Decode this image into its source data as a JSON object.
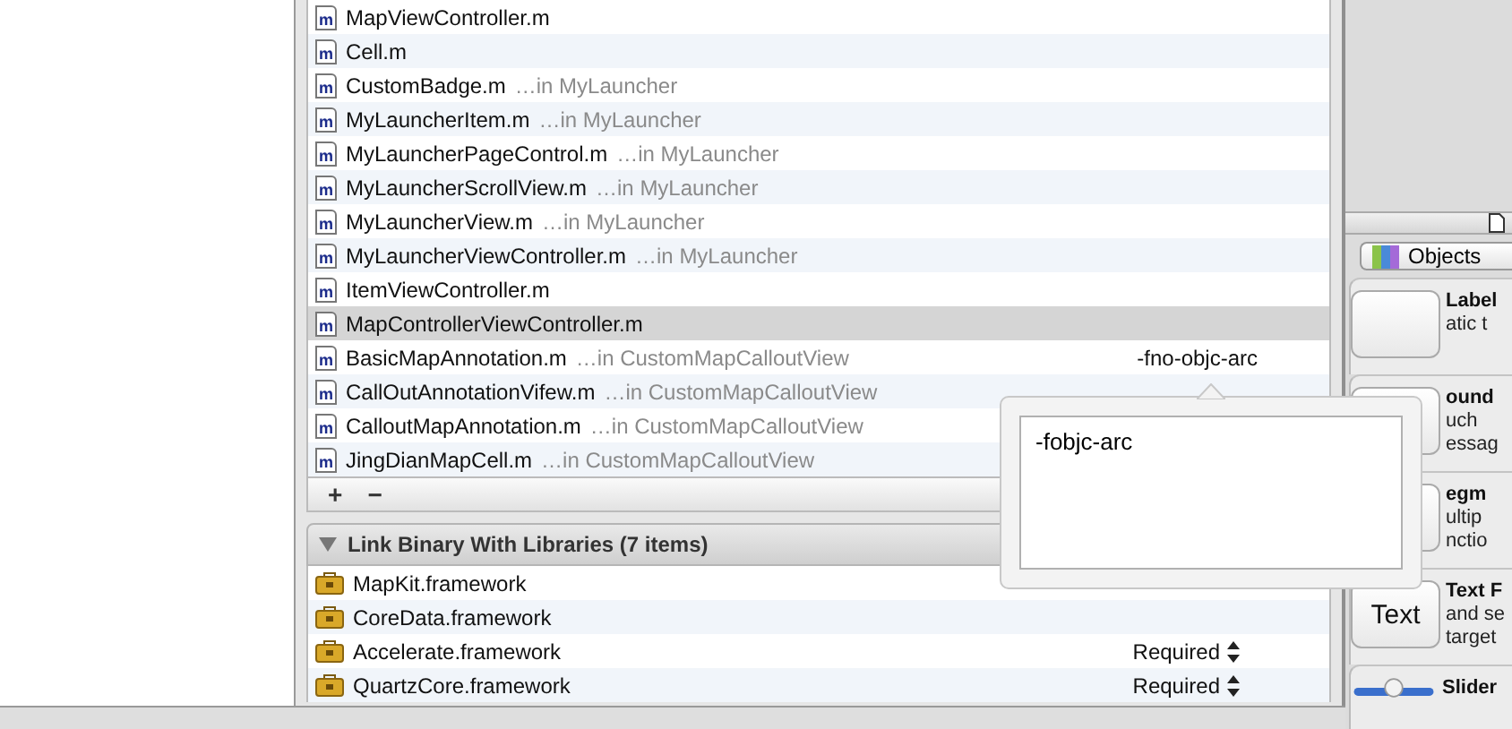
{
  "file_list": {
    "rows": [
      {
        "icon": "m",
        "name": "MapViewController.m",
        "selected": false
      },
      {
        "icon": "m",
        "name": "Cell.m",
        "selected": false
      },
      {
        "icon": "m",
        "name": "CustomBadge.m",
        "location": "…in MyLauncher",
        "selected": false
      },
      {
        "icon": "m",
        "name": "MyLauncherItem.m",
        "location": "…in MyLauncher",
        "selected": false
      },
      {
        "icon": "m",
        "name": "MyLauncherPageControl.m",
        "location": "…in MyLauncher",
        "selected": false
      },
      {
        "icon": "m",
        "name": "MyLauncherScrollView.m",
        "location": "…in MyLauncher",
        "selected": false
      },
      {
        "icon": "m",
        "name": "MyLauncherView.m",
        "location": "…in MyLauncher",
        "selected": false
      },
      {
        "icon": "m",
        "name": "MyLauncherViewController.m",
        "location": "…in MyLauncher",
        "selected": false
      },
      {
        "icon": "m",
        "name": "ItemViewController.m",
        "selected": false
      },
      {
        "icon": "m",
        "name": "MapControllerViewController.m",
        "selected": true
      },
      {
        "icon": "m",
        "name": "BasicMapAnnotation.m",
        "location": "…in CustomMapCalloutView",
        "flags": "-fno-objc-arc",
        "selected": false
      },
      {
        "icon": "m",
        "name": "CallOutAnnotationVifew.m",
        "location": "…in CustomMapCalloutView",
        "selected": false
      },
      {
        "icon": "m",
        "name": "CalloutMapAnnotation.m",
        "location": "…in CustomMapCalloutView",
        "selected": false
      },
      {
        "icon": "m",
        "name": "JingDianMapCell.m",
        "location": "…in CustomMapCalloutView",
        "selected": false
      }
    ],
    "toolbar": [
      "+",
      "−"
    ]
  },
  "libraries": {
    "title": "Link Binary With Libraries (7 items)",
    "expanded": true,
    "rows": [
      {
        "name": "MapKit.framework"
      },
      {
        "name": "CoreData.framework"
      },
      {
        "name": "Accelerate.framework",
        "status": "Required"
      },
      {
        "name": "QuartzCore.framework",
        "status": "Required"
      }
    ]
  },
  "flags_popover": {
    "value": "-fobjc-arc"
  },
  "library_panel": {
    "filter": "Objects",
    "objects": [
      {
        "kind": "label",
        "title": "Label",
        "lines": [
          "atic t"
        ]
      },
      {
        "kind": "button",
        "title": "ound",
        "lines": [
          "uch",
          "essag"
        ]
      },
      {
        "kind": "segmented",
        "title": "egm",
        "lines": [
          "ultip",
          "nctio"
        ]
      },
      {
        "kind": "text-field",
        "icon_text": "Text",
        "title": "Text F",
        "lines": [
          "and se",
          "target"
        ]
      },
      {
        "kind": "slider",
        "title": "Slider"
      }
    ]
  }
}
